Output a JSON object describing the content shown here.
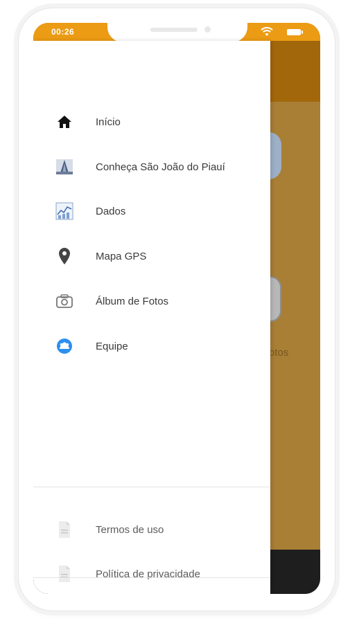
{
  "status_bar": {
    "time": "00:26",
    "wifi_icon": "wifi-icon",
    "battery_icon": "battery-icon",
    "color": "#eb9b14"
  },
  "background_app": {
    "header_color": "#a3670b",
    "body_color": "#a87f35",
    "partial_label": "otos"
  },
  "drawer": {
    "items": [
      {
        "label": "Início",
        "icon": "home-icon"
      },
      {
        "label": "Conheça São João do Piauí",
        "icon": "church-icon"
      },
      {
        "label": "Dados",
        "icon": "data-chart-icon"
      },
      {
        "label": "Mapa GPS",
        "icon": "map-pin-icon"
      },
      {
        "label": "Álbum de Fotos",
        "icon": "camera-icon"
      },
      {
        "label": "Equipe",
        "icon": "team-icon"
      }
    ],
    "footer_items": [
      {
        "label": "Termos de uso",
        "icon": "document-icon"
      },
      {
        "label": "Política de privacidade",
        "icon": "document-icon"
      }
    ]
  }
}
